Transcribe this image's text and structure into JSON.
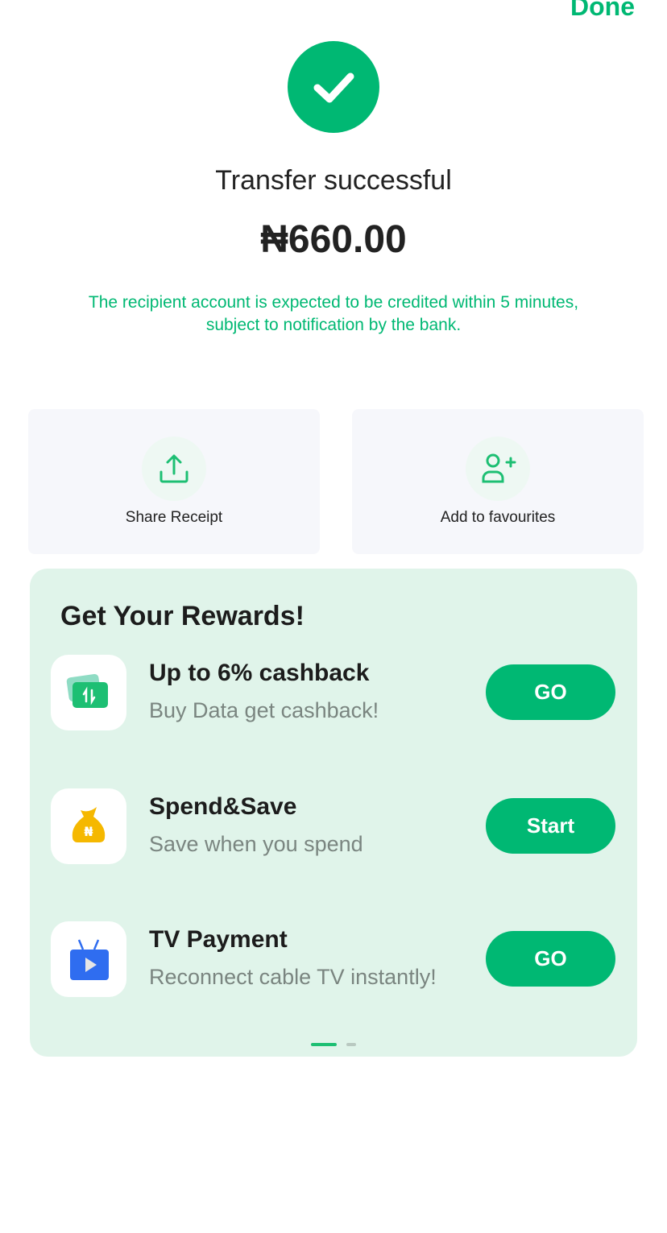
{
  "header": {
    "done_label": "Done"
  },
  "status": {
    "title": "Transfer successful",
    "amount": "₦660.00",
    "note_line1": "The recipient account is expected to be credited within 5 minutes,",
    "note_line2": "subject to notification by the bank."
  },
  "actions": [
    {
      "label": "Share Receipt",
      "icon": "share-icon"
    },
    {
      "label": "Add to favourites",
      "icon": "add-user-icon"
    }
  ],
  "rewards": {
    "title": "Get Your Rewards!",
    "items": [
      {
        "title": "Up to 6% cashback",
        "subtitle": "Buy Data get cashback!",
        "button": "GO",
        "icon": "data-card-icon"
      },
      {
        "title": "Spend&Save",
        "subtitle": "Save when you spend",
        "button": "Start",
        "icon": "money-bag-icon"
      },
      {
        "title": "TV Payment",
        "subtitle": "Reconnect cable TV instantly!",
        "button": "GO",
        "icon": "tv-icon"
      }
    ],
    "page_index": 1,
    "page_count": 2
  },
  "colors": {
    "accent": "#00b873",
    "rewards_bg": "#e0f4ea"
  }
}
